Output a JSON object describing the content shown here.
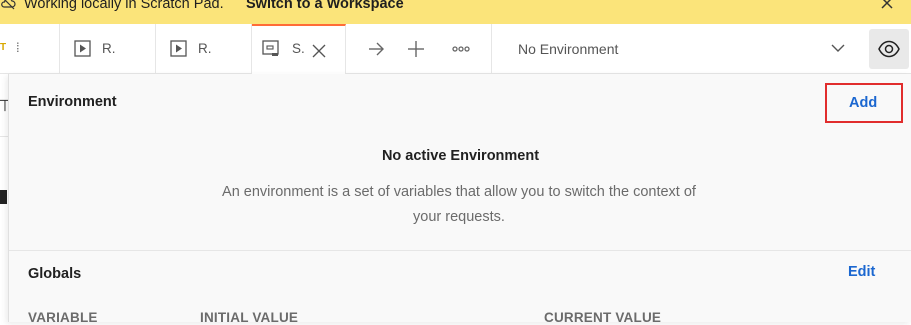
{
  "banner": {
    "message": "Working locally in Scratch Pad.",
    "link": "Switch to a Workspace"
  },
  "tabs": [
    {
      "label": "T ⁞",
      "badge": "T"
    },
    {
      "label": "R.",
      "icon": "run-icon"
    },
    {
      "label": "R.",
      "icon": "run-icon"
    },
    {
      "label": "S.",
      "icon": "save-icon",
      "active": true
    }
  ],
  "toolbar": {
    "environment": "No Environment"
  },
  "environment_panel": {
    "title": "Environment",
    "add_label": "Add",
    "empty_title": "No active Environment",
    "empty_description": "An environment is a set of variables that allow you to switch the context of your requests."
  },
  "globals": {
    "title": "Globals",
    "edit_label": "Edit",
    "columns": [
      "VARIABLE",
      "INITIAL VALUE",
      "CURRENT VALUE"
    ]
  },
  "colors": {
    "banner": "#fbe47a",
    "link": "#1b67d0",
    "highlight": "#e12d2d",
    "accent": "#ff6c37"
  }
}
